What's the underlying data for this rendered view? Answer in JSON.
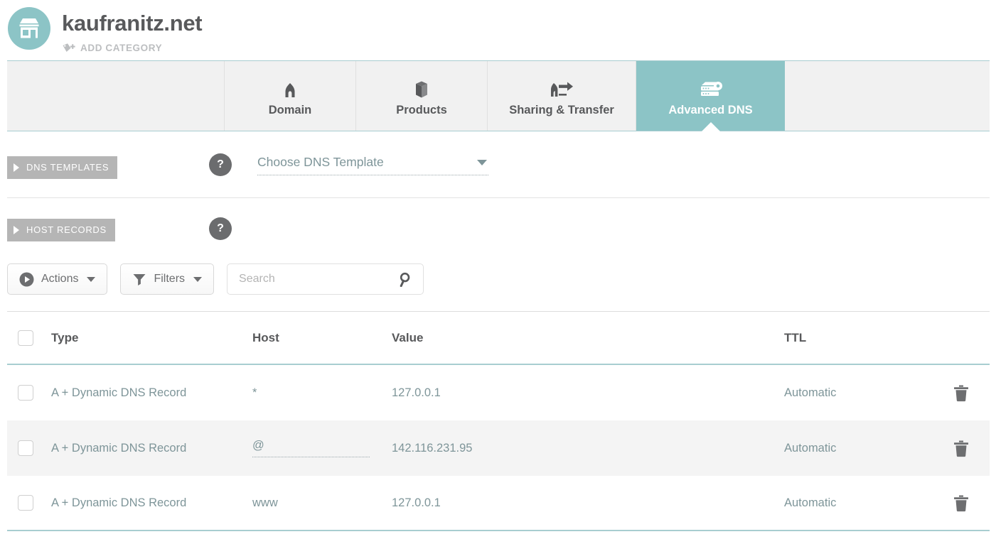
{
  "header": {
    "logo_icon": "storefront-icon",
    "site_title": "kaufranitz.net",
    "add_category_label": "ADD CATEGORY",
    "add_category_icon": "tag-plus-icon"
  },
  "tabs": [
    {
      "label": "Domain",
      "icon": "home-icon",
      "active": false
    },
    {
      "label": "Products",
      "icon": "box-icon",
      "active": false
    },
    {
      "label": "Sharing & Transfer",
      "icon": "share-transfer-icon",
      "active": false
    },
    {
      "label": "Advanced DNS",
      "icon": "server-gear-icon",
      "active": true
    }
  ],
  "dns_templates": {
    "badge_label": "DNS TEMPLATES",
    "help_label": "?",
    "select_value": "Choose DNS Template",
    "caret_icon": "chevron-down-icon"
  },
  "host_records": {
    "badge_label": "HOST RECORDS",
    "help_label": "?"
  },
  "toolbar": {
    "actions_label": "Actions",
    "actions_icon": "play-circle-icon",
    "filters_label": "Filters",
    "filters_icon": "funnel-icon",
    "search_placeholder": "Search",
    "search_value": "",
    "search_icon": "search-icon"
  },
  "table": {
    "columns": [
      "Type",
      "Host",
      "Value",
      "TTL"
    ],
    "rows": [
      {
        "type": "A + Dynamic DNS Record",
        "host": "*",
        "value": "127.0.0.1",
        "ttl": "Automatic",
        "host_editing": false,
        "delete_icon": "trash-icon"
      },
      {
        "type": "A + Dynamic DNS Record",
        "host": "@",
        "value": "142.116.231.95",
        "ttl": "Automatic",
        "host_editing": true,
        "delete_icon": "trash-icon"
      },
      {
        "type": "A + Dynamic DNS Record",
        "host": "www",
        "value": "127.0.0.1",
        "ttl": "Automatic",
        "host_editing": false,
        "delete_icon": "trash-icon"
      }
    ]
  },
  "colors": {
    "teal": "#8cc4c6",
    "teal_border": "#a8cdd0",
    "text_gray": "#58595b",
    "link_gray_blue": "#7e9599",
    "badge_gray": "#b5b5b5",
    "tab_bg": "#f1f1f1",
    "zebra": "#f4f4f4"
  }
}
